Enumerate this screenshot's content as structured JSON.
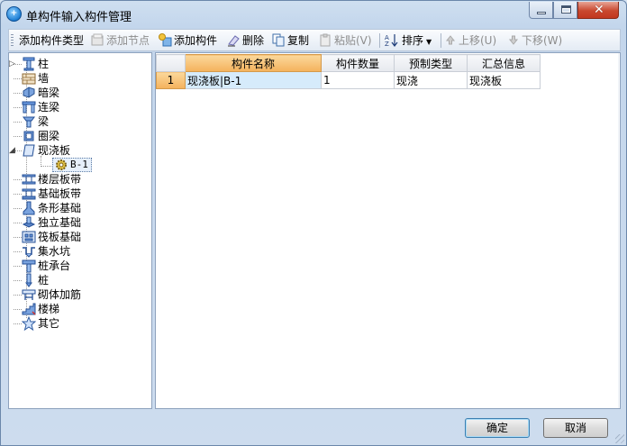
{
  "window": {
    "title": "单构件输入构件管理",
    "app_icon_glyph": "+"
  },
  "toolbar": {
    "add_component_type": "添加构件类型",
    "add_node": "添加节点",
    "add_component": "添加构件",
    "delete": "删除",
    "copy": "复制",
    "paste": "粘贴(V)",
    "sort": "排序",
    "move_up": "上移(U)",
    "move_down": "下移(W)"
  },
  "tree": {
    "items": [
      {
        "label": "柱",
        "icon": "column-icon",
        "expander": "▷"
      },
      {
        "label": "墙",
        "icon": "wall-icon"
      },
      {
        "label": "暗梁",
        "icon": "hidden-beam-icon"
      },
      {
        "label": "连梁",
        "icon": "coupling-beam-icon"
      },
      {
        "label": "梁",
        "icon": "beam-icon"
      },
      {
        "label": "圈梁",
        "icon": "ring-beam-icon"
      },
      {
        "label": "现浇板",
        "icon": "cast-slab-icon",
        "expander": "◢"
      },
      {
        "label": "B-1",
        "icon": "gear-icon",
        "child": true,
        "selected": true
      },
      {
        "label": "楼层板带",
        "icon": "floor-band-icon"
      },
      {
        "label": "基础板带",
        "icon": "foundation-band-icon"
      },
      {
        "label": "条形基础",
        "icon": "strip-foundation-icon"
      },
      {
        "label": "独立基础",
        "icon": "isolated-foundation-icon"
      },
      {
        "label": "筏板基础",
        "icon": "raft-foundation-icon"
      },
      {
        "label": "集水坑",
        "icon": "sump-icon"
      },
      {
        "label": "桩承台",
        "icon": "pile-cap-icon"
      },
      {
        "label": "桩",
        "icon": "pile-icon"
      },
      {
        "label": "砌体加筋",
        "icon": "masonry-rebar-icon"
      },
      {
        "label": "楼梯",
        "icon": "stair-icon"
      },
      {
        "label": "其它",
        "icon": "star-icon"
      }
    ]
  },
  "grid": {
    "columns": [
      "构件名称",
      "构件数量",
      "预制类型",
      "汇总信息"
    ],
    "rows": [
      {
        "num": "1",
        "name": "现浇板|B-1",
        "qty": "1",
        "type": "现浇",
        "summary": "现浇板"
      }
    ]
  },
  "buttons": {
    "ok": "确定",
    "cancel": "取消"
  },
  "colors": {
    "accent_header": "#f4b25c",
    "window_frame": "#6b87aa",
    "close_button": "#c9482f"
  }
}
